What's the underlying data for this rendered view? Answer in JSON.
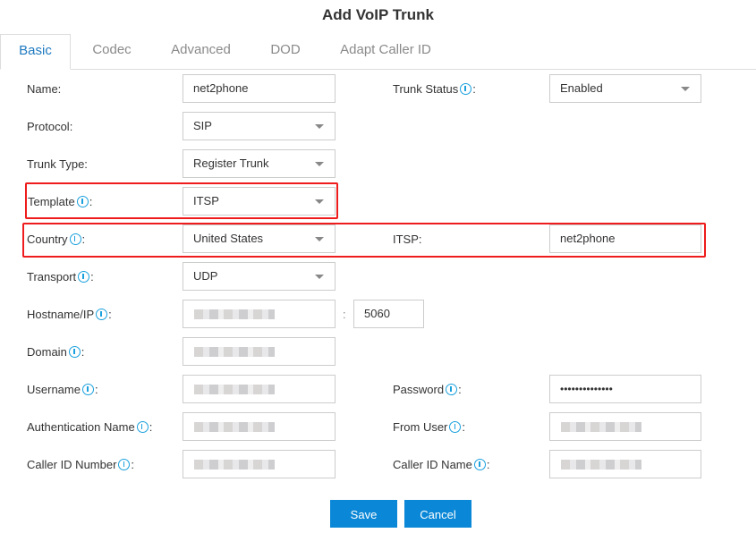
{
  "dialog": {
    "title": "Add VoIP Trunk"
  },
  "tabs": [
    {
      "label": "Basic",
      "active": true
    },
    {
      "label": "Codec",
      "active": false
    },
    {
      "label": "Advanced",
      "active": false
    },
    {
      "label": "DOD",
      "active": false
    },
    {
      "label": "Adapt Caller ID",
      "active": false
    }
  ],
  "form": {
    "name": {
      "label": "Name:",
      "value": "net2phone"
    },
    "trunk_status": {
      "label": "Trunk Status",
      "suffix": ":",
      "value": "Enabled",
      "has_info": true
    },
    "protocol": {
      "label": "Protocol:",
      "value": "SIP"
    },
    "trunk_type": {
      "label": "Trunk Type:",
      "value": "Register Trunk"
    },
    "template": {
      "label": "Template",
      "suffix": ":",
      "value": "ITSP",
      "has_info": true
    },
    "country": {
      "label": "Country",
      "suffix": ":",
      "value": "United States",
      "has_info": true
    },
    "itsp": {
      "label": "ITSP:",
      "value": "net2phone"
    },
    "transport": {
      "label": "Transport",
      "suffix": ":",
      "value": "UDP",
      "has_info": true
    },
    "hostname": {
      "label": "Hostname/IP",
      "suffix": ":",
      "value": "",
      "blurred": true,
      "has_info": true,
      "port_separator": ":",
      "port": "5060"
    },
    "domain": {
      "label": "Domain",
      "suffix": ":",
      "value": "",
      "blurred": true,
      "has_info": true
    },
    "username": {
      "label": "Username",
      "suffix": ":",
      "value": "",
      "blurred": true,
      "has_info": true
    },
    "password": {
      "label": "Password",
      "suffix": ":",
      "value": "••••••••••••••",
      "has_info": true
    },
    "auth_name": {
      "label": "Authentication Name",
      "suffix": ":",
      "value": "",
      "blurred": true,
      "has_info": true
    },
    "from_user": {
      "label": "From User",
      "suffix": ":",
      "value": "",
      "blurred": true,
      "has_info": true
    },
    "caller_id_number": {
      "label": "Caller ID Number",
      "suffix": ":",
      "value": "",
      "blurred": true,
      "has_info": true
    },
    "caller_id_name": {
      "label": "Caller ID Name",
      "suffix": ":",
      "value": "",
      "blurred": true,
      "has_info": true
    }
  },
  "buttons": {
    "save": "Save",
    "cancel": "Cancel"
  },
  "colors": {
    "accent": "#0a87d6",
    "active_tab": "#1f7ac0",
    "info_icon": "#1aa0dd",
    "highlight": "#ee1c1c"
  }
}
